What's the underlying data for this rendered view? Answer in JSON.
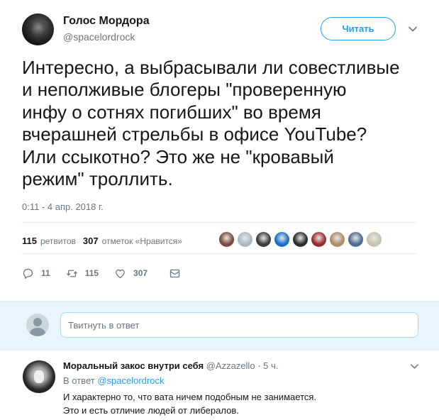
{
  "tweet": {
    "display_name": "Голос Мордора",
    "screen_name": "@spacelordrock",
    "follow_label": "Читать",
    "text": "Интересно, а выбрасывали ли совестливые\nи неполживые блогеры \"проверенную\nинфу о сотнях погибших\" во время\nвчерашней стрельбы в офисе YouTube?\nИли ссыкотно? Это же не \"кровавый\nрежим\" троллить.",
    "timestamp": "0:11 - 4 апр. 2018 г.",
    "stats": {
      "retweets_count": "115",
      "retweets_label": "ретвитов",
      "likes_count": "307",
      "likes_label": "отметок «Нравится»"
    },
    "liker_avatars": [
      {
        "name": "liker-avatar-1",
        "color": "#7a4a3a"
      },
      {
        "name": "liker-avatar-2",
        "color": "#aab8c2"
      },
      {
        "name": "liker-avatar-3",
        "color": "#3b3b3b"
      },
      {
        "name": "liker-avatar-4",
        "color": "#1a6fc9"
      },
      {
        "name": "liker-avatar-5",
        "color": "#2c2c2c"
      },
      {
        "name": "liker-avatar-6",
        "color": "#9b2b2b"
      },
      {
        "name": "liker-avatar-7",
        "color": "#b08a6a"
      },
      {
        "name": "liker-avatar-8",
        "color": "#4f6d8f"
      },
      {
        "name": "liker-avatar-9",
        "color": "#c9c2b0"
      }
    ],
    "actions": {
      "replies": "11",
      "retweets": "115",
      "likes": "307"
    }
  },
  "reply_box": {
    "placeholder": "Твитнуть в ответ"
  },
  "reply": {
    "display_name": "Моральный закос внутри себя",
    "screen_name": "@Azzazello",
    "separator": "·",
    "time": "5 ч.",
    "replying_prefix": "В ответ",
    "replying_to": "@spacelordrock",
    "text": "И характерно то, что вата ничем подобным не занимается.\nЭто и есть отличие людей от либералов."
  },
  "colors": {
    "accent": "#1da1f2",
    "secondary_text": "#657786",
    "reply_box_bg": "#e8f5fd"
  }
}
